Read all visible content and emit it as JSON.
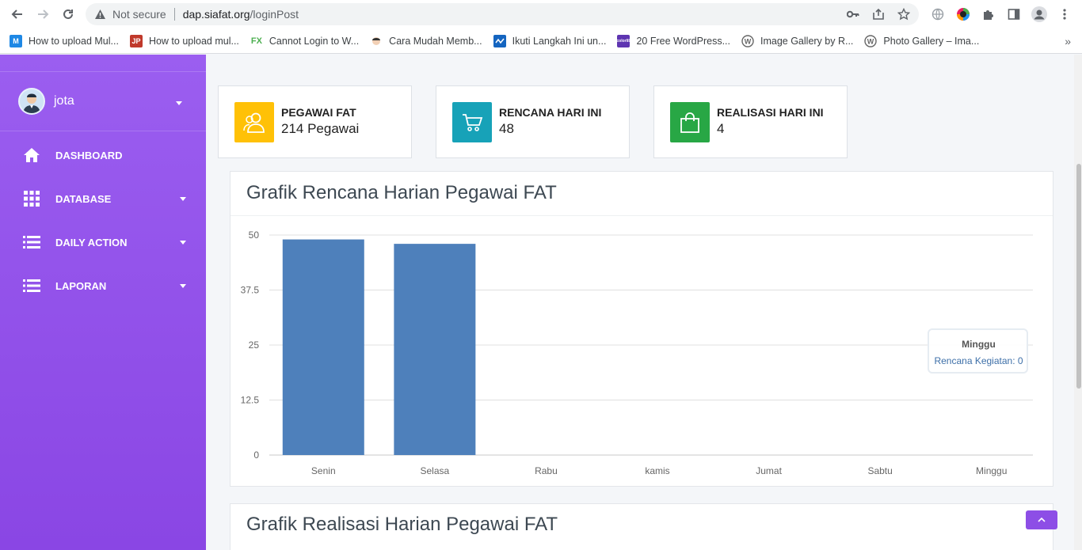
{
  "browser": {
    "security_label": "Not secure",
    "url_host": "dap.siafat.org",
    "url_path": "/loginPost",
    "bookmarks": [
      {
        "label": "How to upload Mul...",
        "icon": "m-logo-icon",
        "color": "#1e88e5"
      },
      {
        "label": "How to upload mul...",
        "icon": "jp-logo-icon",
        "color": "#c0392b"
      },
      {
        "label": "Cannot Login to W...",
        "icon": "fx-logo-icon",
        "color": "#4caf50"
      },
      {
        "label": "Cara Mudah Memb...",
        "icon": "face-icon",
        "color": "#ffffff"
      },
      {
        "label": "Ikuti Langkah Ini un...",
        "icon": "wave-logo-icon",
        "color": "#1565c0"
      },
      {
        "label": "20 Free WordPress...",
        "icon": "colorlib-logo-icon",
        "color": "#5e35b1"
      },
      {
        "label": "Image Gallery by R...",
        "icon": "wordpress-icon",
        "color": "#666666"
      },
      {
        "label": "Photo Gallery – Ima...",
        "icon": "wordpress-icon",
        "color": "#666666"
      }
    ]
  },
  "sidebar": {
    "user_name": "jota",
    "items": [
      {
        "label": "DASHBOARD",
        "icon": "home-icon",
        "has_caret": false
      },
      {
        "label": "DATABASE",
        "icon": "grid-icon",
        "has_caret": true
      },
      {
        "label": "DAILY ACTION",
        "icon": "list-icon",
        "has_caret": true
      },
      {
        "label": "LAPORAN",
        "icon": "list-icon",
        "has_caret": true
      }
    ]
  },
  "info_boxes": [
    {
      "title": "PEGAWAI FAT",
      "value": "214 Pegawai",
      "icon": "users-icon",
      "color": "#ffc107"
    },
    {
      "title": "RENCANA HARI INI",
      "value": "48",
      "icon": "cart-icon",
      "color": "#17a2b8"
    },
    {
      "title": "REALISASI HARI INI",
      "value": "4",
      "icon": "shopping-bag-icon",
      "color": "#28a745"
    }
  ],
  "charts": {
    "rencana_title": "Grafik Rencana Harian Pegawai FAT",
    "realisasi_title": "Grafik Realisasi Harian Pegawai FAT"
  },
  "chart_data": {
    "type": "bar",
    "title": "Grafik Rencana Harian Pegawai FAT",
    "categories": [
      "Senin",
      "Selasa",
      "Rabu",
      "kamis",
      "Jumat",
      "Sabtu",
      "Minggu"
    ],
    "series": [
      {
        "name": "Rencana Kegiatan",
        "values": [
          49,
          48,
          0,
          0,
          0,
          0,
          0
        ],
        "color": "#4e80bb"
      }
    ],
    "ylim": [
      0,
      50
    ],
    "yticks": [
      "0",
      "12.5",
      "25",
      "37.5",
      "50"
    ],
    "grid": true,
    "tooltip": {
      "title": "Minggu",
      "text": "Rencana Kegiatan: 0"
    }
  }
}
